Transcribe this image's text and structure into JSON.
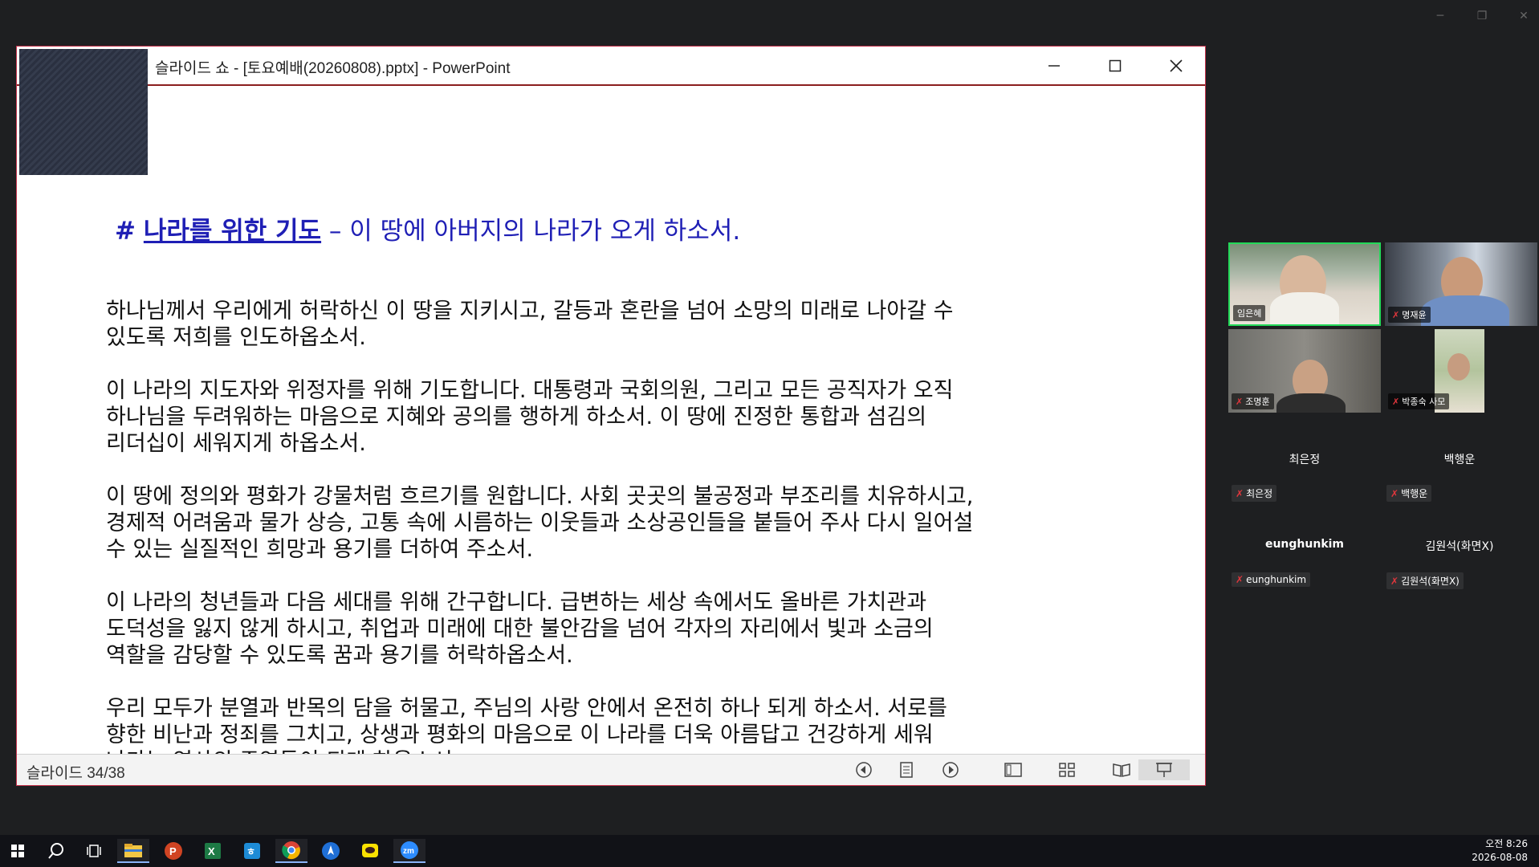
{
  "ppt": {
    "title": "슬라이드 쇼 - [토요예배(20260808).pptx] - PowerPoint",
    "slide": {
      "heading_hash": "#",
      "heading_strong": "나라를 위한 기도",
      "heading_rest": " – 이 땅에 아버지의 나라가 오게 하소서.",
      "paragraphs": [
        "하나님께서 우리에게 허락하신 이 땅을 지키시고, 갈등과 혼란을 넘어 소망의 미래로 나아갈 수\n있도록 저희를 인도하옵소서.",
        "이 나라의 지도자와 위정자를 위해 기도합니다. 대통령과 국회의원, 그리고 모든 공직자가 오직\n하나님을 두려워하는 마음으로 지혜와 공의를 행하게 하소서. 이 땅에 진정한 통합과 섬김의\n리더십이 세워지게 하옵소서.",
        "이 땅에 정의와 평화가 강물처럼 흐르기를 원합니다. 사회 곳곳의 불공정과 부조리를 치유하시고,\n경제적 어려움과 물가 상승, 고통 속에 시름하는 이웃들과 소상공인들을 붙들어 주사 다시 일어설\n수 있는 실질적인 희망과 용기를 더하여 주소서.",
        "이 나라의 청년들과 다음 세대를 위해 간구합니다. 급변하는 세상 속에서도 올바른 가치관과\n도덕성을 잃지 않게 하시고, 취업과 미래에 대한 불안감을 넘어 각자의 자리에서 빛과 소금의\n역할을 감당할 수 있도록 꿈과 용기를 허락하옵소서.",
        "우리 모두가 분열과 반목의 담을 허물고, 주님의 사랑 안에서 온전히 하나 되게 하소서. 서로를\n향한 비난과 정죄를 그치고, 상생과 평화의 마음으로 이 나라를 더욱 아름답고 건강하게 세워\n나가는 역사의 주역들이 되게 하옵소서."
      ]
    },
    "status": {
      "slide_counter": "슬라이드 34/38"
    }
  },
  "gallery": {
    "video_tiles": [
      {
        "name": "임은혜"
      },
      {
        "name": "명재윤"
      },
      {
        "name": "조명훈"
      },
      {
        "name": "박종숙 사모"
      }
    ],
    "name_tiles": [
      {
        "display": "최은정",
        "tag": "최은정"
      },
      {
        "display": "백행운",
        "tag": "백행운"
      },
      {
        "display": "eunghunkim",
        "tag": "eunghunkim"
      },
      {
        "display": "김원석(화면X)",
        "tag": "김원석(화면X)"
      }
    ]
  },
  "taskbar": {
    "clock_time": "오전 8:26",
    "clock_date": "2026-08-08",
    "apps": [
      "start-icon",
      "search-icon",
      "task-view-icon",
      "file-explorer-icon",
      "powerpoint-icon",
      "excel-icon",
      "hancom-icon",
      "chrome-icon",
      "arrow-app-icon",
      "kakaotalk-icon",
      "zoom-icon"
    ]
  },
  "colors": {
    "heading": "#1f1fb5",
    "active_speaker": "#23d959",
    "mic_off": "#e0363c"
  }
}
